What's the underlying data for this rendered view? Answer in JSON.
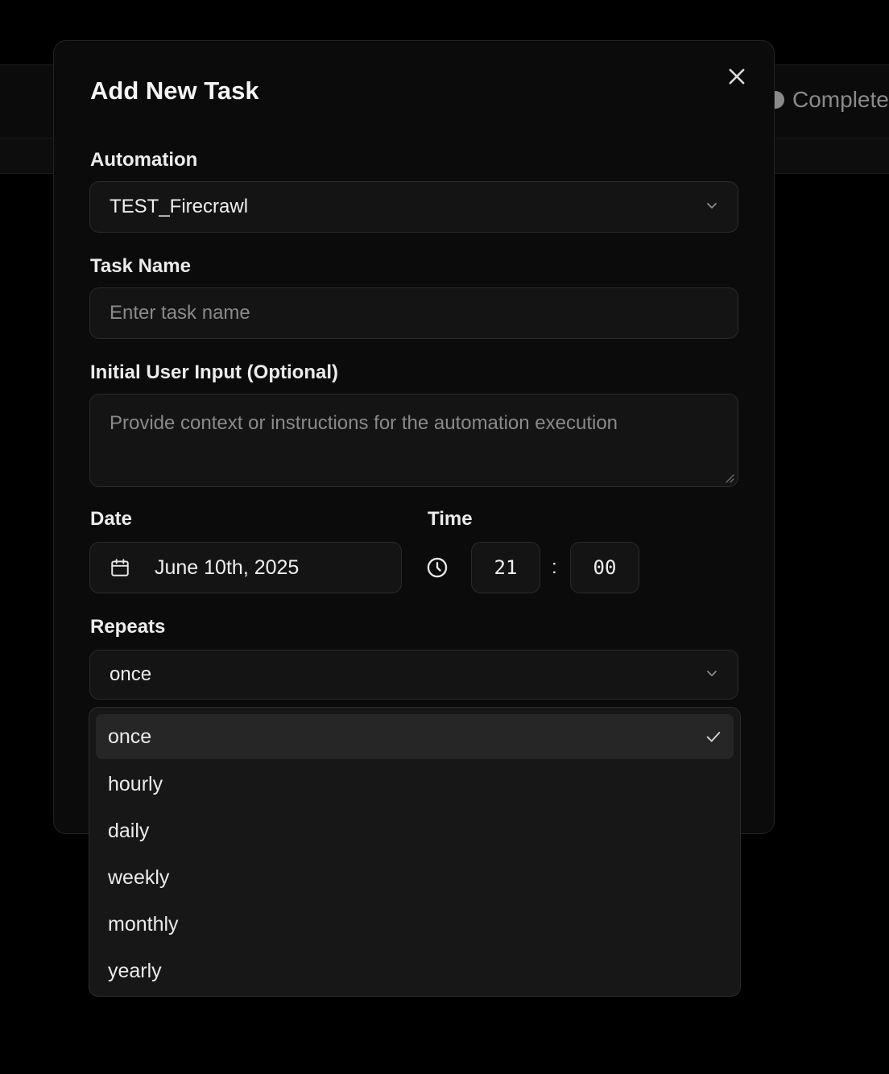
{
  "background": {
    "status_label": "Complete"
  },
  "modal": {
    "title": "Add New Task",
    "automation": {
      "label": "Automation",
      "value": "TEST_Firecrawl"
    },
    "task_name": {
      "label": "Task Name",
      "placeholder": "Enter task name"
    },
    "initial_input": {
      "label": "Initial User Input (Optional)",
      "placeholder": "Provide context or instructions for the automation execution"
    },
    "date": {
      "label": "Date",
      "value": "June 10th, 2025"
    },
    "time": {
      "label": "Time",
      "hour": "21",
      "separator": ":",
      "minute": "00"
    },
    "repeats": {
      "label": "Repeats",
      "value": "once",
      "options": [
        "once",
        "hourly",
        "daily",
        "weekly",
        "monthly",
        "yearly"
      ],
      "selected_index": 0
    }
  },
  "colors": {
    "background": "#000000",
    "modal": "#0b0b0b",
    "field": "#141414",
    "selected_option": "#262626"
  }
}
